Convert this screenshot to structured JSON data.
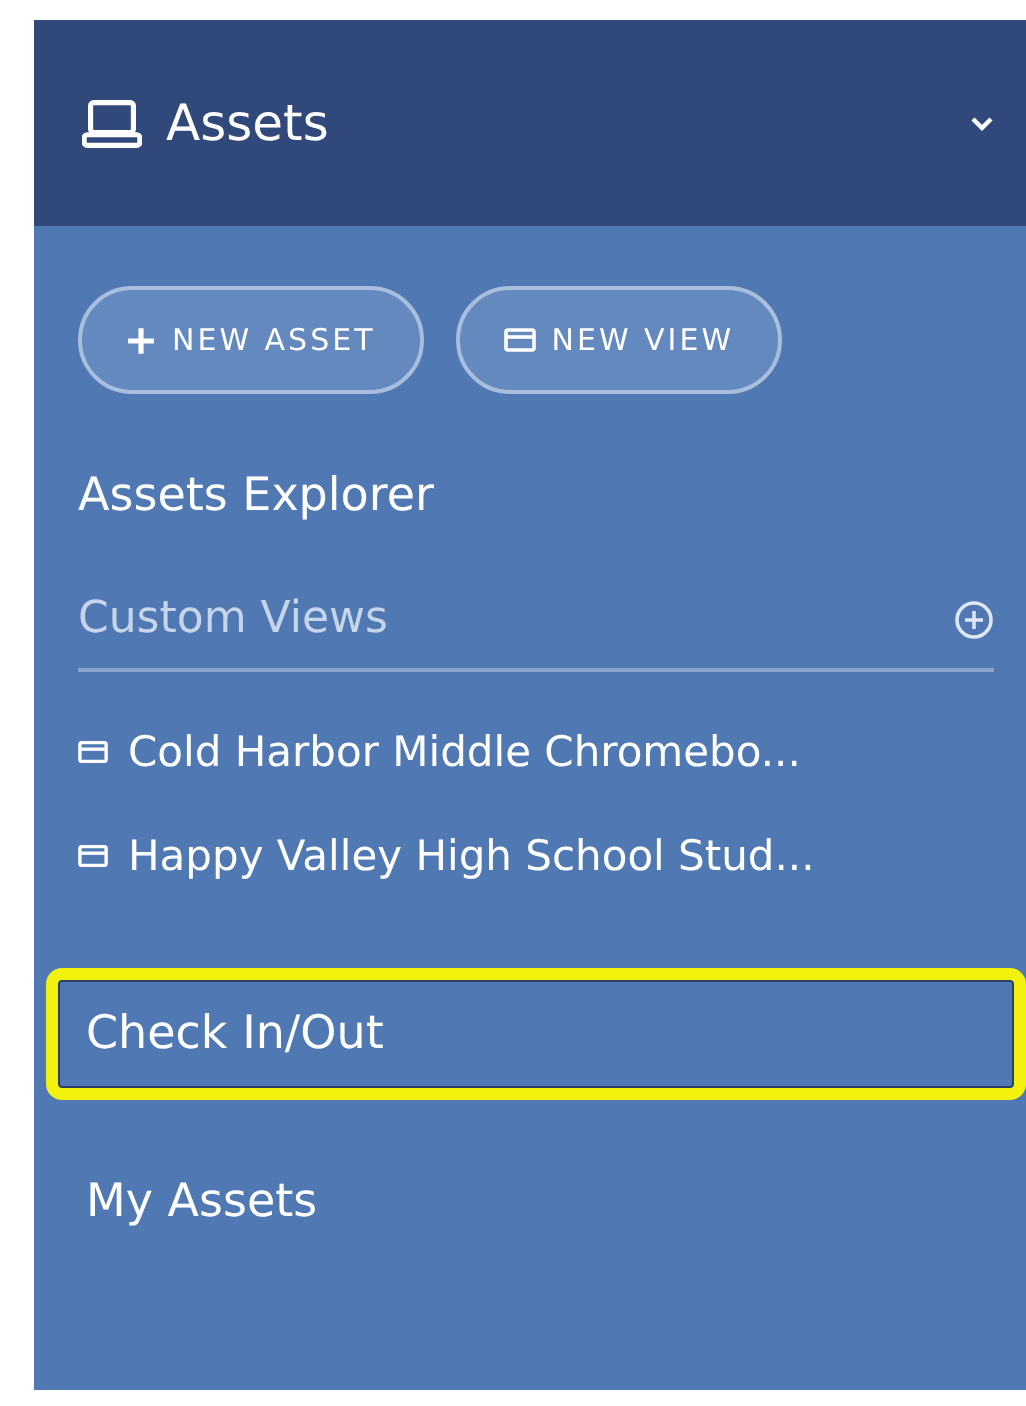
{
  "header": {
    "title": "Assets",
    "expanded": true
  },
  "buttons": [
    {
      "kind": "add",
      "label": "NEW ASSET"
    },
    {
      "kind": "view",
      "label": "NEW VIEW"
    }
  ],
  "explorer": {
    "label": "Assets Explorer"
  },
  "custom_views": {
    "label": "Custom Views",
    "items": [
      {
        "label": "Cold Harbor Middle Chromebo..."
      },
      {
        "label": "Happy Valley High School Stud..."
      }
    ]
  },
  "links": [
    {
      "label": "Check In/Out",
      "highlighted": true
    },
    {
      "label": "My Assets",
      "highlighted": false
    }
  ]
}
